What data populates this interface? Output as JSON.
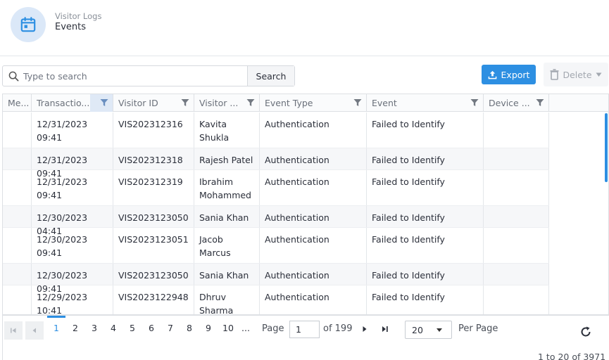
{
  "header": {
    "parent": "Visitor Logs",
    "title": "Events"
  },
  "toolbar": {
    "search_placeholder": "Type to search",
    "search_label": "Search",
    "export_label": "Export",
    "delete_label": "Delete"
  },
  "columns": [
    {
      "label": "Me..."
    },
    {
      "label": "Transactio..."
    },
    {
      "label": "Visitor ID"
    },
    {
      "label": "Visitor ..."
    },
    {
      "label": "Event Type"
    },
    {
      "label": "Event"
    },
    {
      "label": "Device ..."
    }
  ],
  "rows": [
    {
      "me": "",
      "transaction": "12/31/2023 09:41",
      "visitor_id": "VIS202312316",
      "visitor_line1": "Kavita",
      "visitor_line2": "Shukla",
      "event_type": "Authentication",
      "event": "Failed to Identify",
      "device": ""
    },
    {
      "me": "",
      "transaction": "12/31/2023 09:41",
      "visitor_id": "VIS202312318",
      "visitor_line1": "Rajesh Patel",
      "visitor_line2": "",
      "event_type": "Authentication",
      "event": "Failed to Identify",
      "device": ""
    },
    {
      "me": "",
      "transaction": "12/31/2023 09:41",
      "visitor_id": "VIS202312319",
      "visitor_line1": "Ibrahim",
      "visitor_line2": "Mohammed",
      "event_type": "Authentication",
      "event": "Failed to Identify",
      "device": ""
    },
    {
      "me": "",
      "transaction": "12/30/2023 04:41",
      "visitor_id": "VIS2023123050",
      "visitor_line1": "Sania Khan",
      "visitor_line2": "",
      "event_type": "Authentication",
      "event": "Failed to Identify",
      "device": ""
    },
    {
      "me": "",
      "transaction": "12/30/2023 09:41",
      "visitor_id": "VIS2023123051",
      "visitor_line1": "Jacob",
      "visitor_line2": "Marcus",
      "event_type": "Authentication",
      "event": "Failed to Identify",
      "device": ""
    },
    {
      "me": "",
      "transaction": "12/30/2023 09:41",
      "visitor_id": "VIS2023123050",
      "visitor_line1": "Sania Khan",
      "visitor_line2": "",
      "event_type": "Authentication",
      "event": "Failed to Identify",
      "device": ""
    },
    {
      "me": "",
      "transaction": "12/29/2023 10:41",
      "visitor_id": "VIS2023122948",
      "visitor_line1": "Dhruv",
      "visitor_line2": "Sharma",
      "event_type": "Authentication",
      "event": "Failed to Identify",
      "device": ""
    }
  ],
  "pager": {
    "pages": [
      "1",
      "2",
      "3",
      "4",
      "5",
      "6",
      "7",
      "8",
      "9",
      "10",
      "..."
    ],
    "current_page": "1",
    "page_label": "Page",
    "page_input": "1",
    "of_label": "of 199",
    "per_page_value": "20",
    "per_page_label": "Per Page",
    "summary": "1 to 20 of 3971"
  },
  "colors": {
    "accent": "#2d8fe2",
    "icon_bg": "#dbe8f8"
  }
}
